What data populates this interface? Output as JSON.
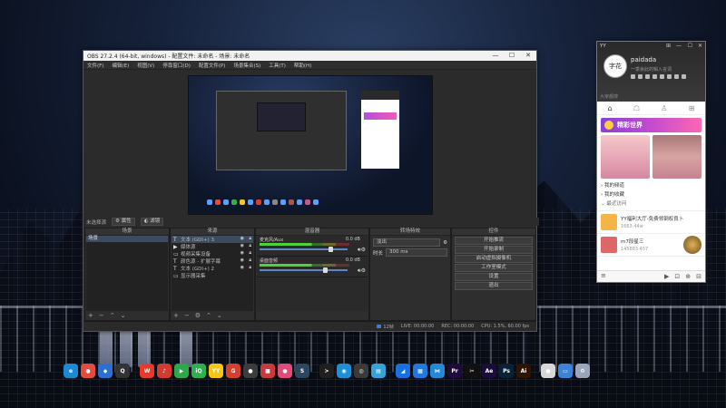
{
  "obs": {
    "title": "OBS 27.2.4 (64-bit, windows) - 配置文件: 未命名 - 场景: 未命名",
    "window_controls": [
      "—",
      "☐",
      "✕"
    ],
    "menu": [
      "文件(F)",
      "编辑(E)",
      "视图(V)",
      "停靠窗口(D)",
      "配置文件(P)",
      "场景集合(S)",
      "工具(T)",
      "帮助(H)"
    ],
    "context_bar": {
      "label": "未选择源",
      "properties": "属性",
      "filters": "滤镜"
    },
    "docks": {
      "scenes": {
        "header": "场景",
        "items": [
          "场景"
        ]
      },
      "sources": {
        "header": "来源",
        "items": [
          {
            "icon": "T",
            "label": "文本 (GDI+) 3"
          },
          {
            "icon": "▶",
            "label": "媒体源"
          },
          {
            "icon": "▭",
            "label": "视频采集设备"
          },
          {
            "icon": "T",
            "label": "颜色源 - 扩展字幕"
          },
          {
            "icon": "T",
            "label": "文本 (GDI+) 2"
          },
          {
            "icon": "▭",
            "label": "显示器采集"
          }
        ]
      },
      "mixer": {
        "header": "混音器",
        "tracks": [
          {
            "name": "麦克风/Aux",
            "db": "0.0 dB",
            "level": 0.58,
            "volume": 0.8
          },
          {
            "name": "桌面音频",
            "db": "0.0 dB",
            "level": 0.62,
            "volume": 0.75
          }
        ]
      },
      "transitions": {
        "header": "转场特效",
        "selected": "淡出",
        "duration_label": "时长",
        "duration_value": "300 ms"
      },
      "controls": {
        "header": "控件",
        "buttons": [
          "开始推流",
          "开始录制",
          "启动虚拟摄像机",
          "工作室模式",
          "设置",
          "退出"
        ]
      }
    },
    "status": {
      "live": "LIVE: 00:00:00",
      "rec": "REC: 00:00:00",
      "cpu": "CPU: 1.5%, 60.00 fps",
      "dropped": "12帧"
    }
  },
  "yy": {
    "app": "YY",
    "window_controls": [
      "⊞",
      "—",
      "☐",
      "✕"
    ],
    "avatar_text": "字花",
    "nickname": "paidada",
    "signature": "一季余此的辑入言词",
    "search_hint": "大家都搜",
    "tabs": [
      "⌂",
      "☖",
      "♙",
      "⊞"
    ],
    "banner": "精彩世界",
    "list": [
      "我的频道",
      "我的收藏",
      "最近访问"
    ],
    "cards": [
      {
        "title": "YY福利大厅-免费领钢权良卜",
        "sub": "1663.44w"
      },
      {
        "title": "m7段星三",
        "sub": "145883·457"
      }
    ],
    "footer_icons": [
      "≡",
      "▶",
      "⊡",
      "⊕",
      "⊟"
    ]
  },
  "taskbar": {
    "apps": [
      {
        "name": "edge-icon",
        "color": "#1a8ad4",
        "glyph": "e"
      },
      {
        "name": "chrome-icon",
        "color": "#e34b3f",
        "glyph": "●"
      },
      {
        "name": "app-blue-icon",
        "color": "#2a6fd1",
        "glyph": "◆"
      },
      {
        "name": "qq-icon",
        "color": "#333333",
        "glyph": "Q"
      },
      {
        "name": "weibo-icon",
        "color": "#e8392a",
        "glyph": "W"
      },
      {
        "name": "netease-music-icon",
        "color": "#d33a31",
        "glyph": "♪"
      },
      {
        "name": "player-icon",
        "color": "#2aa84a",
        "glyph": "▶"
      },
      {
        "name": "iqiyi-icon",
        "color": "#2bb24c",
        "glyph": "iQ"
      },
      {
        "name": "yy-icon",
        "color": "#f5c518",
        "glyph": "YY"
      },
      {
        "name": "app-red-icon",
        "color": "#d63e2e",
        "glyph": "G"
      },
      {
        "name": "app-dark-icon",
        "color": "#3c3c3c",
        "glyph": "●"
      },
      {
        "name": "app-red2-icon",
        "color": "#c93a3a",
        "glyph": "■"
      },
      {
        "name": "app-pink-icon",
        "color": "#e04b7a",
        "glyph": "●"
      },
      {
        "name": "steam-icon",
        "color": "#2a475e",
        "glyph": "S"
      },
      {
        "name": "terminal-icon",
        "color": "#1f1f1f",
        "glyph": ">"
      },
      {
        "name": "app-cyan-icon",
        "color": "#1c8fd6",
        "glyph": "◉"
      },
      {
        "name": "obs-icon",
        "color": "#3a3a3a",
        "glyph": "◎"
      },
      {
        "name": "gallery-icon",
        "color": "#35a3d8",
        "glyph": "▤"
      },
      {
        "name": "feishu-icon",
        "color": "#1a6fe0",
        "glyph": "◢"
      },
      {
        "name": "app-blue2-icon",
        "color": "#2277dd",
        "glyph": "▦"
      },
      {
        "name": "vscode-icon",
        "color": "#2489d6",
        "glyph": "⋈"
      },
      {
        "name": "premiere-icon",
        "color": "#1f0a40",
        "glyph": "Pr"
      },
      {
        "name": "capcut-icon",
        "color": "#111111",
        "glyph": "✂"
      },
      {
        "name": "after-effects-icon",
        "color": "#1a0d3d",
        "glyph": "Ae"
      },
      {
        "name": "photoshop-icon",
        "color": "#0a2238",
        "glyph": "Ps"
      },
      {
        "name": "illustrator-icon",
        "color": "#2d1500",
        "glyph": "Ai"
      },
      {
        "name": "app-white-icon",
        "color": "#d8d8d8",
        "glyph": "●"
      },
      {
        "name": "explorer-icon",
        "color": "#3b83d9",
        "glyph": "▭"
      },
      {
        "name": "recycle-bin-icon",
        "color": "#9aa7b8",
        "glyph": "♻"
      }
    ]
  }
}
